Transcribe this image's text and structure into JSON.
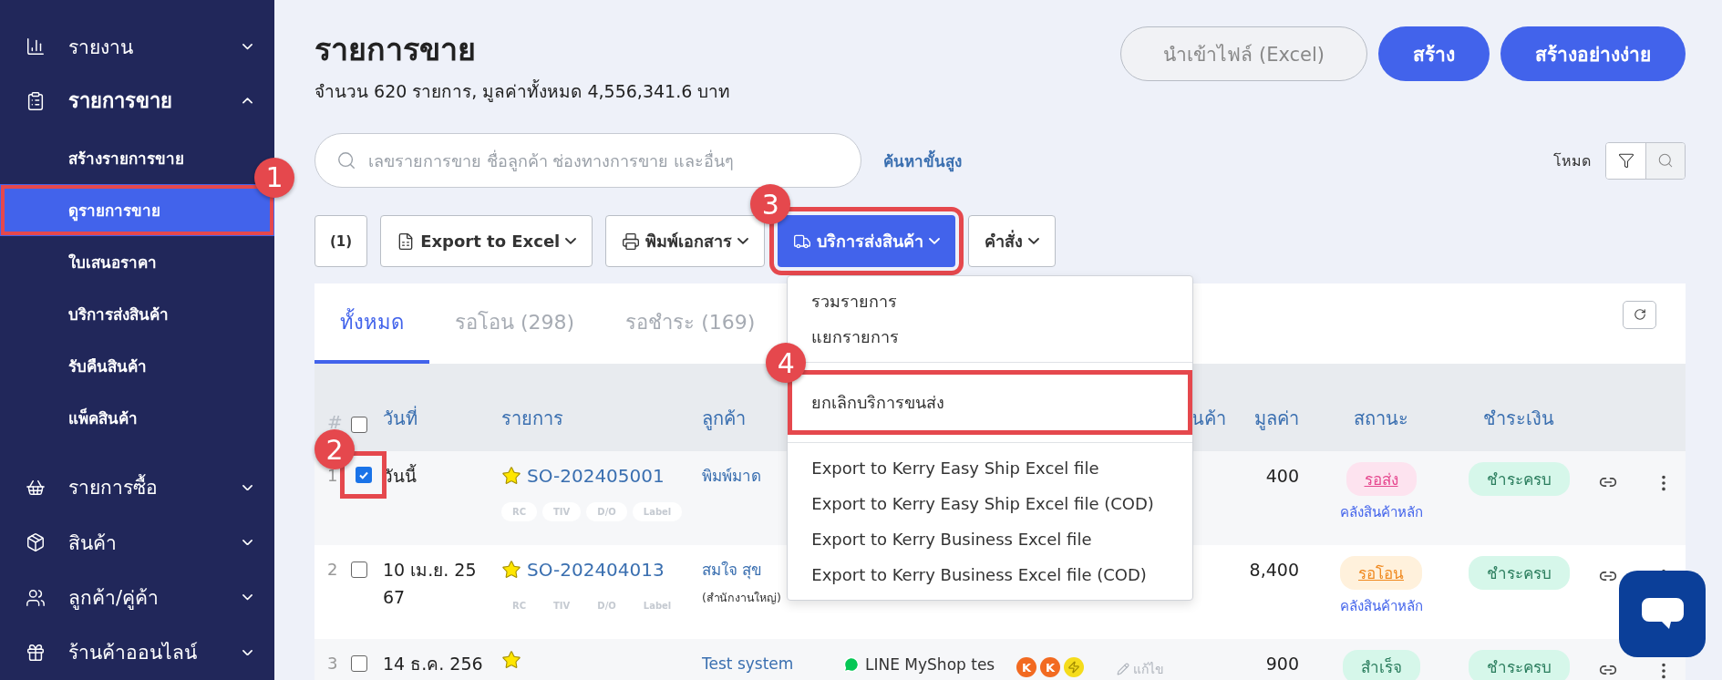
{
  "sidebar": {
    "items": [
      {
        "label": "รายงาน",
        "expanded": false
      },
      {
        "label": "รายการขาย",
        "expanded": true,
        "children": [
          {
            "label": "สร้างรายการขาย",
            "selected": false
          },
          {
            "label": "ดูรายการขาย",
            "selected": true,
            "callout": "1"
          },
          {
            "label": "ใบเสนอราคา",
            "selected": false
          },
          {
            "label": "บริการส่งสินค้า",
            "selected": false
          },
          {
            "label": "รับคืนสินค้า",
            "selected": false
          },
          {
            "label": "แพ็คสินค้า",
            "selected": false
          }
        ]
      },
      {
        "label": "รายการซื้อ",
        "expanded": false
      },
      {
        "label": "สินค้า",
        "expanded": false
      },
      {
        "label": "ลูกค้า/คู่ค้า",
        "expanded": false
      },
      {
        "label": "ร้านค้าออนไลน์",
        "expanded": false
      }
    ]
  },
  "header": {
    "title": "รายการขาย",
    "summary": "จำนวน 620 รายการ, มูลค่าทั้งหมด 4,556,341.6 บาท",
    "buttons": [
      {
        "label": "นำเข้าไฟล์ (Excel)",
        "kind": "secondary"
      },
      {
        "label": "สร้าง",
        "kind": "primary"
      },
      {
        "label": "สร้างอย่างง่าย",
        "kind": "primary"
      }
    ]
  },
  "search": {
    "placeholder": "เลขรายการขาย ชื่อลูกค้า ช่องทางการขาย และอื่นๆ",
    "advanced_link": "ค้นหาขั้นสูง"
  },
  "mode_toggle": {
    "label": "โหมด",
    "options": [
      {
        "selected": true
      },
      {
        "selected": false
      }
    ]
  },
  "toolbar": [
    {
      "label": "(1)",
      "kind": "count",
      "open": false
    },
    {
      "label": "Export to Excel",
      "kind": "excel",
      "open": false
    },
    {
      "label": "พิมพ์เอกสาร",
      "kind": "print",
      "open": false
    },
    {
      "label": "บริการส่งสินค้า",
      "kind": "shipping",
      "open": true,
      "callout": "3",
      "menu": [
        [
          {
            "label": "รวมรายการ"
          },
          {
            "label": "แยกรายการ"
          }
        ],
        [
          {
            "label": "ยกเลิกบริการขนส่ง",
            "callout": "4"
          }
        ],
        [
          {
            "label": "Export to Kerry Easy Ship Excel file"
          },
          {
            "label": "Export to Kerry Easy Ship Excel file (COD)"
          },
          {
            "label": "Export to Kerry Business Excel file"
          },
          {
            "label": "Export to Kerry Business Excel file (COD)"
          }
        ]
      ]
    },
    {
      "label": "คำสั่ง",
      "kind": "command",
      "open": false
    }
  ],
  "tabs": [
    {
      "label": "ทั้งหมด",
      "selected": true
    },
    {
      "label": "รอโอน (298)",
      "selected": false
    },
    {
      "label": "รอชำระ (169)",
      "selected": false
    }
  ],
  "table": {
    "header_checked": false,
    "columns": [
      {
        "kind": "num",
        "label": "#"
      },
      {
        "kind": "date",
        "label": "วันที่"
      },
      {
        "kind": "order",
        "label": "รายการ"
      },
      {
        "kind": "customer",
        "label": "ลูกค้า"
      },
      {
        "kind": "product",
        "label": "นค้า"
      },
      {
        "kind": "value",
        "label": "มูลค่า"
      },
      {
        "kind": "status",
        "label": "สถานะ"
      },
      {
        "kind": "payment",
        "label": "ชำระเงิน"
      }
    ],
    "rows": [
      {
        "number": "1",
        "checked": true,
        "callout": "2",
        "date": "วันนี้",
        "starred": true,
        "order_no": "SO-202405001",
        "tags": [
          "RC",
          "TIV",
          "D/O",
          "Label"
        ],
        "customer": "พิมพ์มาด",
        "value": "400",
        "status": {
          "label": "รอส่ง",
          "kind": "to_ship"
        },
        "warehouse": "คลังสินค้าหลัก",
        "payment": {
          "label": "ชำระครบ",
          "kind": "paid"
        }
      },
      {
        "number": "2",
        "checked": false,
        "date": "10 เม.ย. 2567",
        "starred": true,
        "order_no": "SO-202404013",
        "tags": [
          "RC",
          "TIV",
          "D/O",
          "Label"
        ],
        "customer": "สมใจ สุข",
        "customer_branch": "(สำนักงานใหญ่)",
        "value": "8,400",
        "status": {
          "label": "รอโอน",
          "kind": "to_transfer"
        },
        "warehouse": "คลังสินค้าหลัก",
        "payment": {
          "label": "ชำระครบ",
          "kind": "paid"
        }
      },
      {
        "number": "3",
        "checked": false,
        "date": "14 ธ.ค. 256",
        "starred": true,
        "customer": "Test system",
        "channel": "LINE MyShop tes",
        "carriers": [
          {
            "kind": "letter",
            "mark": "K",
            "color": "#f26a21"
          },
          {
            "kind": "letter",
            "mark": "K",
            "color": "#f26a21"
          },
          {
            "kind": "bolt",
            "color": "#f5dc1c"
          }
        ],
        "edit": "แก้ไข",
        "value": "900",
        "status": {
          "label": "สำเร็จ",
          "kind": "done"
        },
        "payment": {
          "label": "ชำระครบ",
          "kind": "paid"
        }
      }
    ]
  }
}
